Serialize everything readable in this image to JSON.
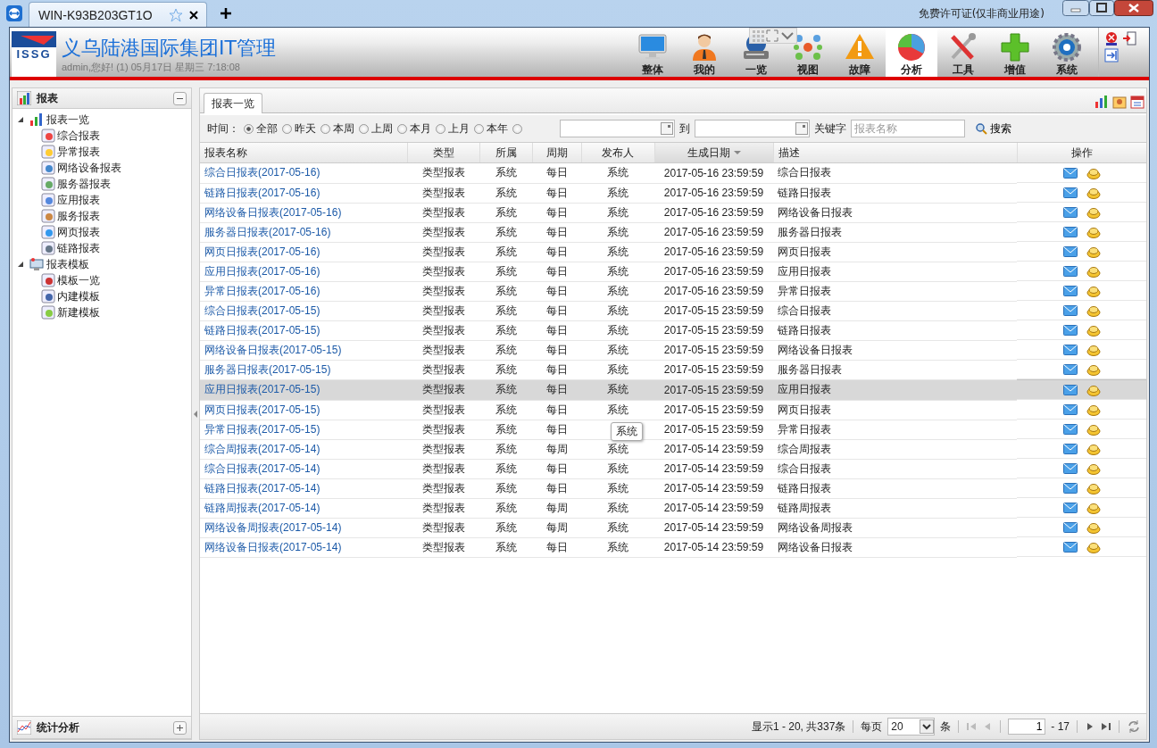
{
  "browser": {
    "tab_title": "WIN-K93B203GT1O",
    "license": "免费许可证(仅非商业用途)"
  },
  "header": {
    "title": "义乌陆港国际集团IT管理",
    "subtitle": "admin,您好! (1) 05月17日 星期三 7:18:08",
    "logo_text": "ISSG",
    "nav": [
      {
        "label": "整体",
        "selected": false
      },
      {
        "label": "我的",
        "selected": false
      },
      {
        "label": "一览",
        "selected": false
      },
      {
        "label": "视图",
        "selected": false
      },
      {
        "label": "故障",
        "selected": false
      },
      {
        "label": "分析",
        "selected": true
      },
      {
        "label": "工具",
        "selected": false
      },
      {
        "label": "增值",
        "selected": false
      },
      {
        "label": "系统",
        "selected": false
      }
    ]
  },
  "sidebar": {
    "title": "报表",
    "expanded": true,
    "items": [
      {
        "label": "报表一览",
        "expanded": true,
        "children": [
          {
            "label": "综合报表"
          },
          {
            "label": "异常报表"
          },
          {
            "label": "网络设备报表"
          },
          {
            "label": "服务器报表"
          },
          {
            "label": "应用报表"
          },
          {
            "label": "服务报表"
          },
          {
            "label": "网页报表"
          },
          {
            "label": "链路报表"
          }
        ]
      },
      {
        "label": "报表模板",
        "expanded": true,
        "children": [
          {
            "label": "模板一览"
          },
          {
            "label": "内建模板"
          },
          {
            "label": "新建模板"
          }
        ]
      }
    ],
    "bottom_panel": {
      "title": "统计分析",
      "expanded": false
    }
  },
  "main": {
    "tabs": [
      {
        "label": "报表一览",
        "selected": true
      }
    ],
    "filter": {
      "label": "时间：",
      "options": [
        {
          "label": "全部",
          "selected": true
        },
        {
          "label": "昨天",
          "selected": false
        },
        {
          "label": "本周",
          "selected": false
        },
        {
          "label": "上周",
          "selected": false
        },
        {
          "label": "本月",
          "selected": false
        },
        {
          "label": "上月",
          "selected": false
        },
        {
          "label": "本年",
          "selected": false
        },
        {
          "selected": false
        }
      ],
      "to_label": "到",
      "keyword_label": "关键字",
      "keyword_placeholder": "报表名称",
      "search": "搜索"
    },
    "table": {
      "columns": [
        {
          "label": "报表名称",
          "sorted": false
        },
        {
          "label": "类型",
          "sorted": false
        },
        {
          "label": "所属",
          "sorted": false
        },
        {
          "label": "周期",
          "sorted": false
        },
        {
          "label": "发布人",
          "sorted": false
        },
        {
          "label": "生成日期",
          "sorted": true
        },
        {
          "label": "描述",
          "sorted": false
        },
        {
          "label": "操作",
          "sorted": false
        }
      ],
      "rows": [
        {
          "name": "综合日报表(2017-05-16)",
          "type": "类型报表",
          "owner": "系统",
          "period": "每日",
          "publisher": "系统",
          "date": "2017-05-16 23:59:59",
          "desc": "综合日报表",
          "hovered": false
        },
        {
          "name": "链路日报表(2017-05-16)",
          "type": "类型报表",
          "owner": "系统",
          "period": "每日",
          "publisher": "系统",
          "date": "2017-05-16 23:59:59",
          "desc": "链路日报表",
          "hovered": false
        },
        {
          "name": "网络设备日报表(2017-05-16)",
          "type": "类型报表",
          "owner": "系统",
          "period": "每日",
          "publisher": "系统",
          "date": "2017-05-16 23:59:59",
          "desc": "网络设备日报表",
          "hovered": false
        },
        {
          "name": "服务器日报表(2017-05-16)",
          "type": "类型报表",
          "owner": "系统",
          "period": "每日",
          "publisher": "系统",
          "date": "2017-05-16 23:59:59",
          "desc": "服务器日报表",
          "hovered": false
        },
        {
          "name": "网页日报表(2017-05-16)",
          "type": "类型报表",
          "owner": "系统",
          "period": "每日",
          "publisher": "系统",
          "date": "2017-05-16 23:59:59",
          "desc": "网页日报表",
          "hovered": false
        },
        {
          "name": "应用日报表(2017-05-16)",
          "type": "类型报表",
          "owner": "系统",
          "period": "每日",
          "publisher": "系统",
          "date": "2017-05-16 23:59:59",
          "desc": "应用日报表",
          "hovered": false
        },
        {
          "name": "异常日报表(2017-05-16)",
          "type": "类型报表",
          "owner": "系统",
          "period": "每日",
          "publisher": "系统",
          "date": "2017-05-16 23:59:59",
          "desc": "异常日报表",
          "hovered": false
        },
        {
          "name": "综合日报表(2017-05-15)",
          "type": "类型报表",
          "owner": "系统",
          "period": "每日",
          "publisher": "系统",
          "date": "2017-05-15 23:59:59",
          "desc": "综合日报表",
          "hovered": false
        },
        {
          "name": "链路日报表(2017-05-15)",
          "type": "类型报表",
          "owner": "系统",
          "period": "每日",
          "publisher": "系统",
          "date": "2017-05-15 23:59:59",
          "desc": "链路日报表",
          "hovered": false
        },
        {
          "name": "网络设备日报表(2017-05-15)",
          "type": "类型报表",
          "owner": "系统",
          "period": "每日",
          "publisher": "系统",
          "date": "2017-05-15 23:59:59",
          "desc": "网络设备日报表",
          "hovered": false
        },
        {
          "name": "服务器日报表(2017-05-15)",
          "type": "类型报表",
          "owner": "系统",
          "period": "每日",
          "publisher": "系统",
          "date": "2017-05-15 23:59:59",
          "desc": "服务器日报表",
          "hovered": false
        },
        {
          "name": "应用日报表(2017-05-15)",
          "type": "类型报表",
          "owner": "系统",
          "period": "每日",
          "publisher": "系统",
          "date": "2017-05-15 23:59:59",
          "desc": "应用日报表",
          "hovered": true
        },
        {
          "name": "网页日报表(2017-05-15)",
          "type": "类型报表",
          "owner": "系统",
          "period": "每日",
          "publisher": "系统",
          "date": "2017-05-15 23:59:59",
          "desc": "网页日报表",
          "hovered": false
        },
        {
          "name": "异常日报表(2017-05-15)",
          "type": "类型报表",
          "owner": "系统",
          "period": "每日",
          "date": "2017-05-15 23:59:59",
          "desc": "异常日报表",
          "hovered": false
        },
        {
          "name": "综合周报表(2017-05-14)",
          "type": "类型报表",
          "owner": "系统",
          "period": "每周",
          "publisher": "系统",
          "date": "2017-05-14 23:59:59",
          "desc": "综合周报表",
          "hovered": false
        },
        {
          "name": "综合日报表(2017-05-14)",
          "type": "类型报表",
          "owner": "系统",
          "period": "每日",
          "publisher": "系统",
          "date": "2017-05-14 23:59:59",
          "desc": "综合日报表",
          "hovered": false
        },
        {
          "name": "链路日报表(2017-05-14)",
          "type": "类型报表",
          "owner": "系统",
          "period": "每日",
          "publisher": "系统",
          "date": "2017-05-14 23:59:59",
          "desc": "链路日报表",
          "hovered": false
        },
        {
          "name": "链路周报表(2017-05-14)",
          "type": "类型报表",
          "owner": "系统",
          "period": "每周",
          "publisher": "系统",
          "date": "2017-05-14 23:59:59",
          "desc": "链路周报表",
          "hovered": false
        },
        {
          "name": "网络设备周报表(2017-05-14)",
          "type": "类型报表",
          "owner": "系统",
          "period": "每周",
          "publisher": "系统",
          "date": "2017-05-14 23:59:59",
          "desc": "网络设备周报表",
          "hovered": false
        },
        {
          "name": "网络设备日报表(2017-05-14)",
          "type": "类型报表",
          "owner": "系统",
          "period": "每日",
          "publisher": "系统",
          "date": "2017-05-14 23:59:59",
          "desc": "网络设备日报表",
          "hovered": false
        }
      ]
    },
    "tooltip": {
      "text": "系统"
    },
    "pager": {
      "summary": "显示1 - 20, 共337条",
      "per_page_label": "每页",
      "per_page": "20",
      "unit": "条",
      "page": "1",
      "total": "- 17"
    }
  }
}
